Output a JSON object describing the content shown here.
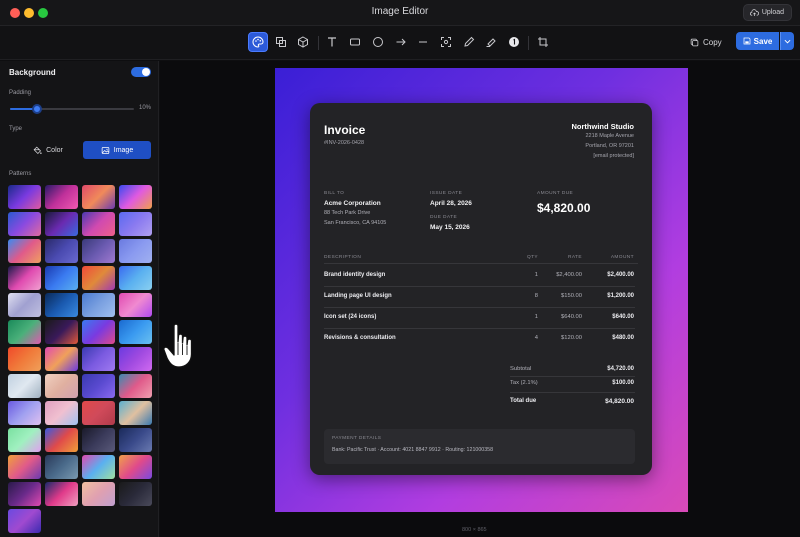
{
  "window": {
    "title": "Image Editor",
    "upload_label": "Upload"
  },
  "toolbar": {
    "tools": [
      "palette-tool",
      "crop-frames-tool",
      "3d-tool",
      "text-tool",
      "rectangle-tool",
      "circle-tool",
      "arrow-tool",
      "line-tool",
      "focus-tool",
      "pen-tool",
      "highlighter-tool",
      "step-number-tool",
      "crop-tool"
    ],
    "active_tool": "palette-tool",
    "copy_label": "Copy",
    "save_label": "Save",
    "accent": "#2d6ce0"
  },
  "sidebar": {
    "background_heading": "Background",
    "background_enabled": true,
    "padding_label": "Padding",
    "padding_value": "10%",
    "padding_fraction": 0.22,
    "type_label": "Type",
    "type_options": [
      "Color",
      "Image"
    ],
    "type_selected": "Image",
    "patterns_label": "Patterns"
  },
  "patterns": [
    "linear-gradient(135deg,#1a2a8a,#7a3ae0,#e05aa0)",
    "linear-gradient(135deg,#2a1a6a,#c0309a,#f05ab0)",
    "linear-gradient(135deg,#e04a6a,#f08a5a,#6a3ab0)",
    "linear-gradient(135deg,#3a4af0,#e05ae0,#f0a04a)",
    "linear-gradient(135deg,#2a5ad0,#8a4ae0,#e06aa0)",
    "linear-gradient(135deg,#1a1a3a,#6a2ab0,#3a6ae0)",
    "linear-gradient(135deg,#4a3ab0,#d04ab0,#f0608a)",
    "linear-gradient(135deg,#5a6af0,#8a7af0,#b0a0f0)",
    "linear-gradient(135deg,#3a8af0,#e05a8a,#f0a060)",
    "linear-gradient(135deg,#2a2a6a,#4a4ab0,#6a6ad0)",
    "linear-gradient(135deg,#3a3a7a,#6a5ab0,#a07ad0)",
    "linear-gradient(135deg,#6a7ae0,#8a9af0,#a0b0f0)",
    "linear-gradient(135deg,#1a1a4a,#e04ab0,#f0a0d0)",
    "linear-gradient(135deg,#1a3ab0,#3a7af0,#5ab0f0)",
    "linear-gradient(135deg,#f04a3a,#e08a3a,#a03ab0)",
    "linear-gradient(135deg,#3a6af0,#5ab0f0,#8ad0f0)",
    "linear-gradient(135deg,#e0e0f0,#a0a0d0,#c0c0e0)",
    "linear-gradient(135deg,#0a2a5a,#1a5ab0,#3a8ae0)",
    "linear-gradient(135deg,#4a7ad0,#7aa0e0,#a0c0f0)",
    "linear-gradient(135deg,#e04ab0,#f08ad0,#b04af0)",
    "linear-gradient(135deg,#1a8a5a,#4ab07a,#e05ab0)",
    "linear-gradient(135deg,#1a1a1a,#3a1a5a,#e05a3a)",
    "linear-gradient(135deg,#3a7af0,#7a3ae0,#e04a8a)",
    "linear-gradient(135deg,#1a6ad0,#3a9af0,#6ac0f0)",
    "linear-gradient(135deg,#f04a2a,#f07a3a,#f0a05a)",
    "linear-gradient(135deg,#e04ab0,#f0a05a,#6a3ae0)",
    "linear-gradient(135deg,#3a3ab0,#7a5ae0,#a07af0)",
    "linear-gradient(135deg,#6a3ae0,#a04ae0,#d06af0)",
    "linear-gradient(135deg,#c0d0e0,#e0e8f0,#a0b0c0)",
    "linear-gradient(135deg,#f0d0c0,#e0b0a0,#d0a0b0)",
    "linear-gradient(135deg,#3a3ab0,#5a4ad0,#8a6af0)",
    "linear-gradient(135deg,#3a8ab0,#e05a8a,#f0a0b0)",
    "linear-gradient(135deg,#6a5ae0,#a0a0f0,#e0c0f0)",
    "linear-gradient(135deg,#e0a0c0,#f0c0d0,#a0c0f0)",
    "linear-gradient(135deg,#e04a4a,#d04a5a,#b03a4a)",
    "linear-gradient(135deg,#5ab0d0,#e0c0a0,#3a7ab0)",
    "linear-gradient(135deg,#7ae0a0,#a0f0c0,#e0a0f0)",
    "linear-gradient(135deg,#3a5ae0,#e04a4a,#f0a03a)",
    "linear-gradient(135deg,#1a1a2a,#3a3a5a,#5a5a7a)",
    "linear-gradient(135deg,#1a2a5a,#3a4a8a,#6a7ab0)",
    "linear-gradient(135deg,#f0a03a,#e05a8a,#6a3ab0)",
    "linear-gradient(135deg,#2a3a5a,#4a6a8a,#7a9ab0)",
    "linear-gradient(135deg,#e04ab0,#5ab0f0,#a0e0a0)",
    "linear-gradient(135deg,#f0a04a,#e04a8a,#7a4ae0)",
    "linear-gradient(135deg,#2a1a4a,#6a2a8a,#e04ab0)",
    "linear-gradient(135deg,#1a2a6a,#e03a8a,#f0a0c0)",
    "linear-gradient(135deg,#f0c0a0,#e0a0b0,#c0a0d0)",
    "linear-gradient(135deg,#1a1a1a,#2a2a3a,#4a4a5a)",
    "linear-gradient(135deg,#6a4ae0,#a04ad0,#3a2ab0)"
  ],
  "invoice": {
    "title": "Invoice",
    "number": "#INV-2026-0428",
    "company": "Northwind Studio",
    "company_address": [
      "2218 Maple Avenue",
      "Portland, OR 97201",
      "[email protected]"
    ],
    "bill_to_label": "BILL TO",
    "bill_to_name": "Acme Corporation",
    "bill_to_address": [
      "88 Tech Park Drive",
      "San Francisco, CA 94105"
    ],
    "issue_date_label": "ISSUE DATE",
    "issue_date": "April 28, 2026",
    "due_date_label": "DUE DATE",
    "due_date": "May 15, 2026",
    "amount_due_label": "AMOUNT DUE",
    "amount_due": "$4,820.00",
    "columns": [
      "DESCRIPTION",
      "QTY",
      "RATE",
      "AMOUNT"
    ],
    "items": [
      {
        "description": "Brand identity design",
        "qty": "1",
        "rate": "$2,400.00",
        "amount": "$2,400.00"
      },
      {
        "description": "Landing page UI design",
        "qty": "8",
        "rate": "$150.00",
        "amount": "$1,200.00"
      },
      {
        "description": "Icon set (24 icons)",
        "qty": "1",
        "rate": "$640.00",
        "amount": "$640.00"
      },
      {
        "description": "Revisions & consultation",
        "qty": "4",
        "rate": "$120.00",
        "amount": "$480.00"
      }
    ],
    "subtotal_label": "Subtotal",
    "subtotal": "$4,720.00",
    "tax_label": "Tax (2.1%)",
    "tax": "$100.00",
    "total_label": "Total due",
    "total": "$4,820.00",
    "payment_label": "PAYMENT DETAILS",
    "payment_details": "Bank: Pacific Trust · Account: 4021 8847 9912 · Routing: 121000358"
  },
  "canvas": {
    "dimensions_label": "800 × 865"
  }
}
